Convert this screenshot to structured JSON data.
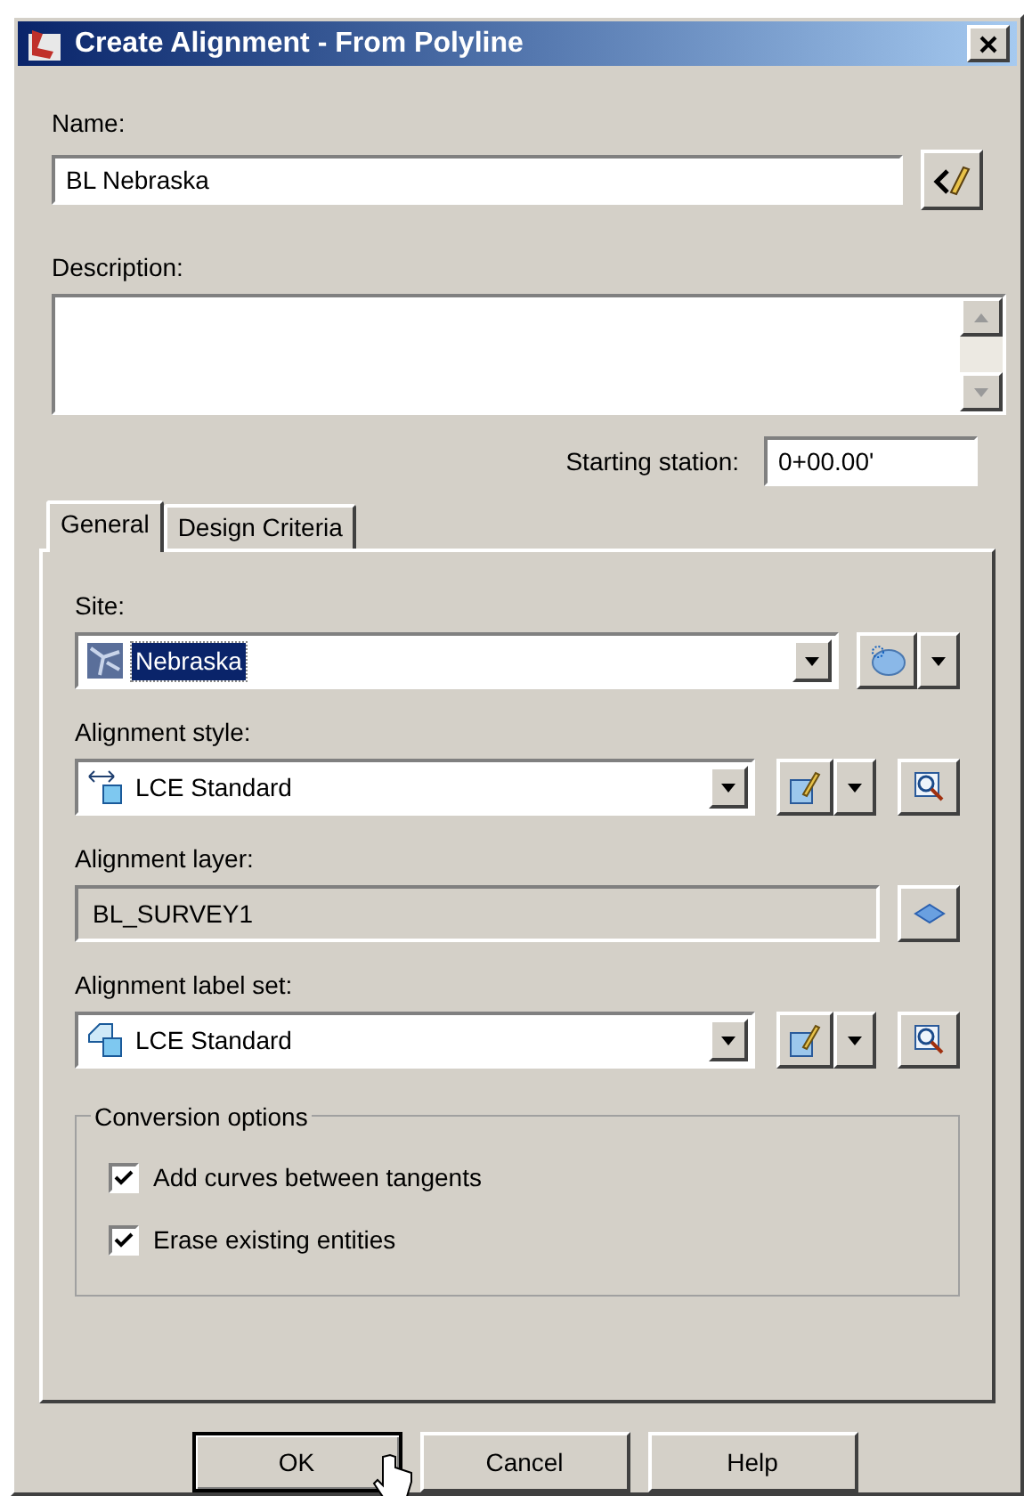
{
  "window": {
    "title": "Create Alignment - From Polyline"
  },
  "name": {
    "label": "Name:",
    "value": "BL Nebraska"
  },
  "description": {
    "label": "Description:"
  },
  "starting_station": {
    "label": "Starting station:",
    "value": "0+00.00'"
  },
  "tabs": [
    {
      "label": "General",
      "selected": true
    },
    {
      "label": "Design Criteria",
      "selected": false
    }
  ],
  "fields": [
    {
      "kind": "site",
      "label": "Site:",
      "value": "Nebraska",
      "highlighted": true
    },
    {
      "kind": "style",
      "label": "Alignment style:",
      "value": "LCE Standard",
      "highlighted": false
    },
    {
      "kind": "layer",
      "label": "Alignment layer:",
      "value": "BL_SURVEY1"
    },
    {
      "kind": "labelset",
      "label": "Alignment label set:",
      "value": "LCE Standard",
      "highlighted": false
    }
  ],
  "conversion_options": {
    "title": "Conversion options",
    "options": [
      {
        "label": "Add curves between tangents",
        "checked": true
      },
      {
        "label": "Erase existing entities",
        "checked": true
      }
    ]
  },
  "buttons": [
    {
      "label": "OK",
      "default": true
    },
    {
      "label": "Cancel",
      "default": false
    },
    {
      "label": "Help",
      "default": false
    }
  ]
}
